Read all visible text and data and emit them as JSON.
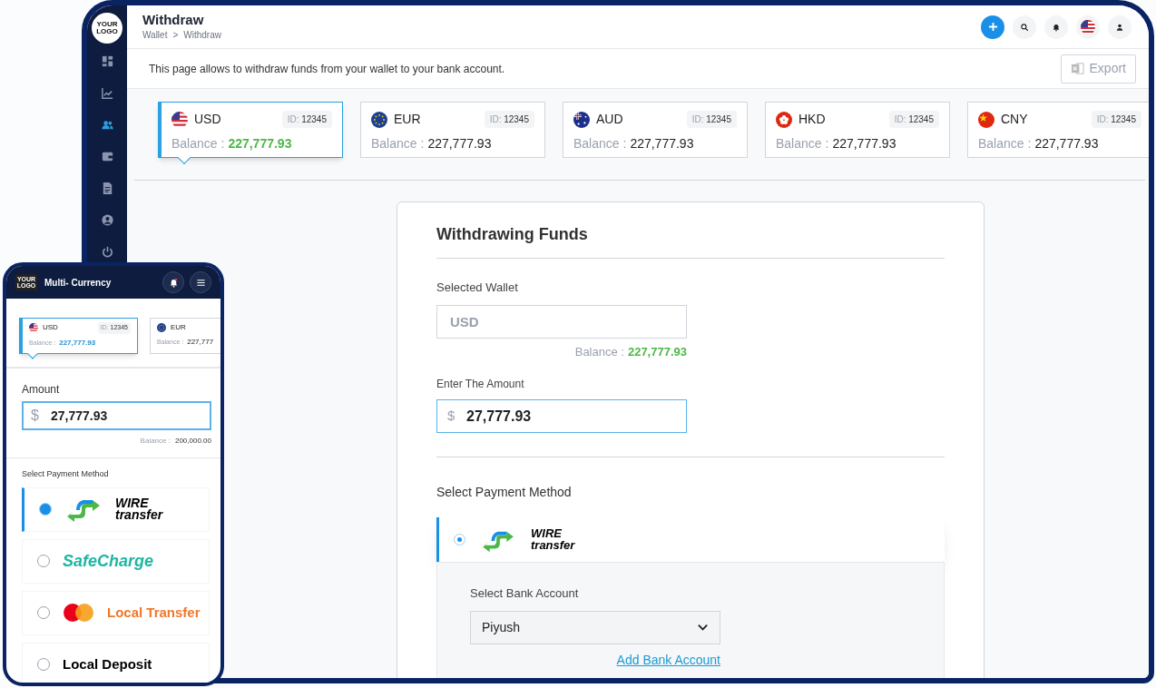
{
  "desktop": {
    "logo": "YOUR LOGO",
    "title": "Withdraw",
    "breadcrumb": [
      "Wallet",
      "Withdraw"
    ],
    "breadcrumb_separator": ">",
    "sidebar_items": [
      {
        "kind": "grid",
        "selected": false
      },
      {
        "kind": "chart",
        "selected": false
      },
      {
        "kind": "users",
        "selected": true
      },
      {
        "kind": "wallet",
        "selected": false
      },
      {
        "kind": "document",
        "selected": false
      },
      {
        "kind": "account",
        "selected": false
      },
      {
        "kind": "power",
        "selected": false
      }
    ],
    "description": "This page allows to withdraw funds from your wallet to your bank account.",
    "export_button": "Export",
    "wallets": [
      {
        "kind": "us",
        "code": "USD",
        "id_label": "ID:",
        "id": "12345",
        "balance_label": "Balance :",
        "balance": "227,777.93",
        "selected": true
      },
      {
        "kind": "eu",
        "code": "EUR",
        "id_label": "ID:",
        "id": "12345",
        "balance_label": "Balance :",
        "balance": "227,777.93",
        "selected": false
      },
      {
        "kind": "au",
        "code": "AUD",
        "id_label": "ID:",
        "id": "12345",
        "balance_label": "Balance :",
        "balance": "227,777.93",
        "selected": false
      },
      {
        "kind": "hk",
        "code": "HKD",
        "id_label": "ID:",
        "id": "12345",
        "balance_label": "Balance :",
        "balance": "227,777.93",
        "selected": false
      },
      {
        "kind": "cn",
        "code": "CNY",
        "id_label": "ID:",
        "id": "12345",
        "balance_label": "Balance :",
        "balance": "227,777.93",
        "selected": false
      }
    ],
    "form": {
      "title": "Withdrawing Funds",
      "wallet_label": "Selected Wallet",
      "wallet_placeholder": "USD",
      "balance_label": "Balance :",
      "balance": "227,777.93",
      "amount_label": "Enter The Amount",
      "currency_symbol": "$",
      "amount": "27,777.93",
      "payment_label": "Select Payment Method",
      "payment_methods": [
        {
          "kind": "wire",
          "label": "WIRE transfer",
          "selected": true
        }
      ],
      "bank_label": "Select Bank Account",
      "bank_value": "Piyush",
      "add_bank_link": "Add Bank Account"
    }
  },
  "mobile": {
    "logo": "YOUR LOGO",
    "title": "Multi- Currency",
    "wallets": [
      {
        "kind": "us",
        "code": "USD",
        "id_label": "ID:",
        "id": "12345",
        "balance_label": "Balance :",
        "balance": "227,777.93",
        "selected": true
      },
      {
        "kind": "eu",
        "code": "EUR",
        "balance_label": "Balance :",
        "balance": "227,777",
        "selected": false
      }
    ],
    "amount_label": "Amount",
    "currency_symbol": "$",
    "amount": "27,777.93",
    "balance_label": "Balance :",
    "balance": "200,000.00",
    "payment_label": "Select Payment Method",
    "payment_methods": [
      {
        "kind": "wire",
        "label": "WIRE transfer",
        "selected": true
      },
      {
        "kind": "safecharge",
        "label": "SafeCharge",
        "selected": false
      },
      {
        "kind": "mastercard",
        "label": "Local Transfer",
        "selected": false
      },
      {
        "kind": "plain",
        "label": "Local Deposit",
        "selected": false
      }
    ]
  }
}
